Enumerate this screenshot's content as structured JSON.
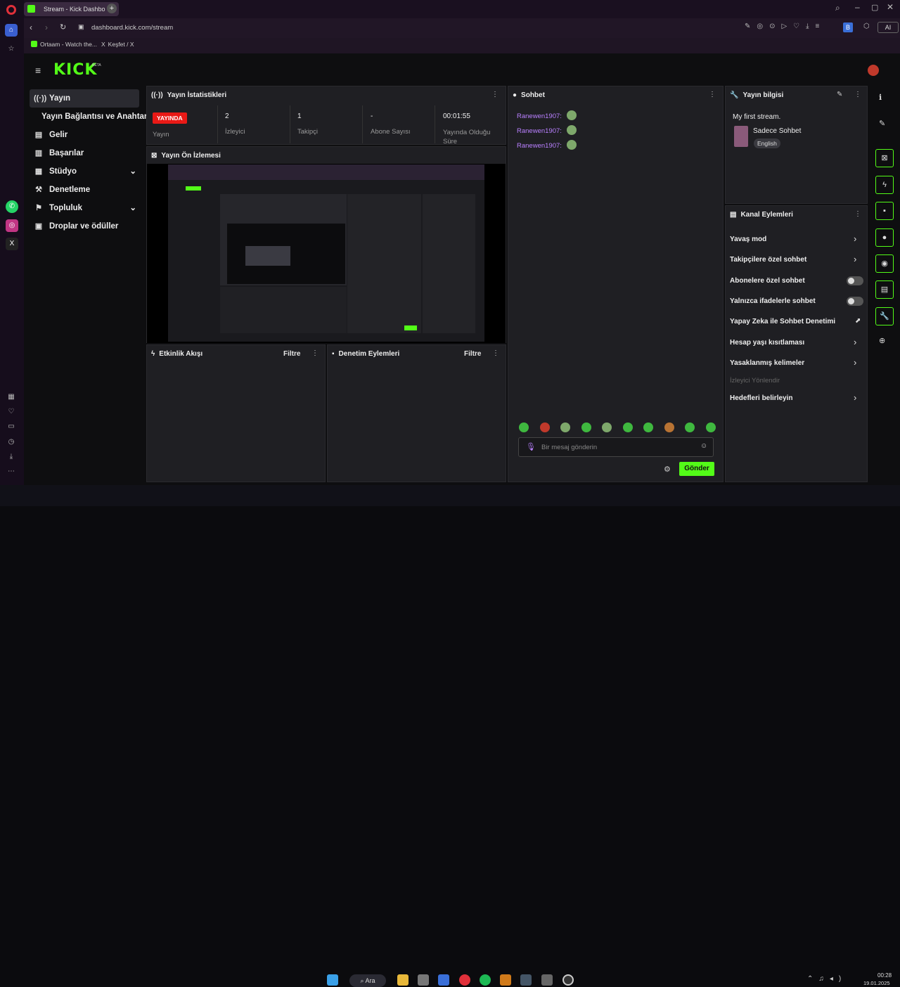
{
  "browser": {
    "tab_title": "Stream - Kick Dashbo",
    "new_tab": "+",
    "url": "dashboard.kick.com/stream",
    "bookmarks": [
      "Ortaam - Watch the...",
      "Keşfet / X"
    ],
    "profile_badge": "B",
    "ai_label": "AI"
  },
  "header": {
    "logo": "KICK",
    "logo_beta": "BETA"
  },
  "sidebar": {
    "items": [
      {
        "label": "Yayın",
        "icon": "broadcast-icon"
      },
      {
        "label": "Yayın Bağlantısı ve Anahtarı",
        "icon": ""
      },
      {
        "label": "Gelir",
        "icon": "wallet-icon"
      },
      {
        "label": "Başarılar",
        "icon": "trophy-icon"
      },
      {
        "label": "Stüdyo",
        "icon": "studio-icon"
      },
      {
        "label": "Denetleme",
        "icon": "hammer-icon"
      },
      {
        "label": "Topluluk",
        "icon": "community-icon"
      },
      {
        "label": "Droplar ve ödüller",
        "icon": "gift-icon"
      }
    ]
  },
  "stats": {
    "title": "Yayın İstatistikleri",
    "live_badge": "YAYINDA",
    "live_label": "Yayın",
    "viewers_val": "2",
    "viewers_lbl": "İzleyici",
    "followers_val": "1",
    "followers_lbl": "Takipçi",
    "subs_val": "-",
    "subs_lbl": "Abone Sayısı",
    "uptime_val": "00:01:55",
    "uptime_lbl": "Yayında Olduğu Süre"
  },
  "preview": {
    "title": "Yayın Ön İzlemesi"
  },
  "activity": {
    "title": "Etkinlik Akışı",
    "filter": "Filtre"
  },
  "modlog": {
    "title": "Denetim Eylemleri",
    "filter": "Filtre"
  },
  "chat": {
    "title": "Sohbet",
    "messages": [
      {
        "user": "Ranewen1907:"
      },
      {
        "user": "Ranewen1907:"
      },
      {
        "user": "Ranewen1907:"
      }
    ],
    "placeholder": "Bir mesaj gönderin",
    "send": "Gönder"
  },
  "info": {
    "title": "Yayın bilgisi",
    "stream_title": "My first stream.",
    "category": "Sadece Sohbet",
    "language": "English"
  },
  "actions": {
    "title": "Kanal Eylemleri",
    "items": [
      {
        "label": "Yavaş mod",
        "control": "chevron"
      },
      {
        "label": "Takipçilere özel sohbet",
        "control": "chevron"
      },
      {
        "label": "Abonelere özel sohbet",
        "control": "toggle"
      },
      {
        "label": "Yalnızca ifadelerle sohbet",
        "control": "toggle"
      },
      {
        "label": "Yapay Zeka ile Sohbet Denetimi",
        "control": "chart"
      },
      {
        "label": "Hesap yaşı kısıtlaması",
        "control": "chevron"
      },
      {
        "label": "Yasaklanmış kelimeler",
        "control": "chevron"
      }
    ],
    "disabled": "İzleyici Yönlendir",
    "last": "Hedefleri belirleyin"
  },
  "taskbar": {
    "search": "Ara",
    "time": "00:28",
    "date": "19.01.2025"
  },
  "colors": {
    "kick_green": "#53fc18",
    "live_red": "#e91916",
    "username_purple": "#b980ff"
  }
}
